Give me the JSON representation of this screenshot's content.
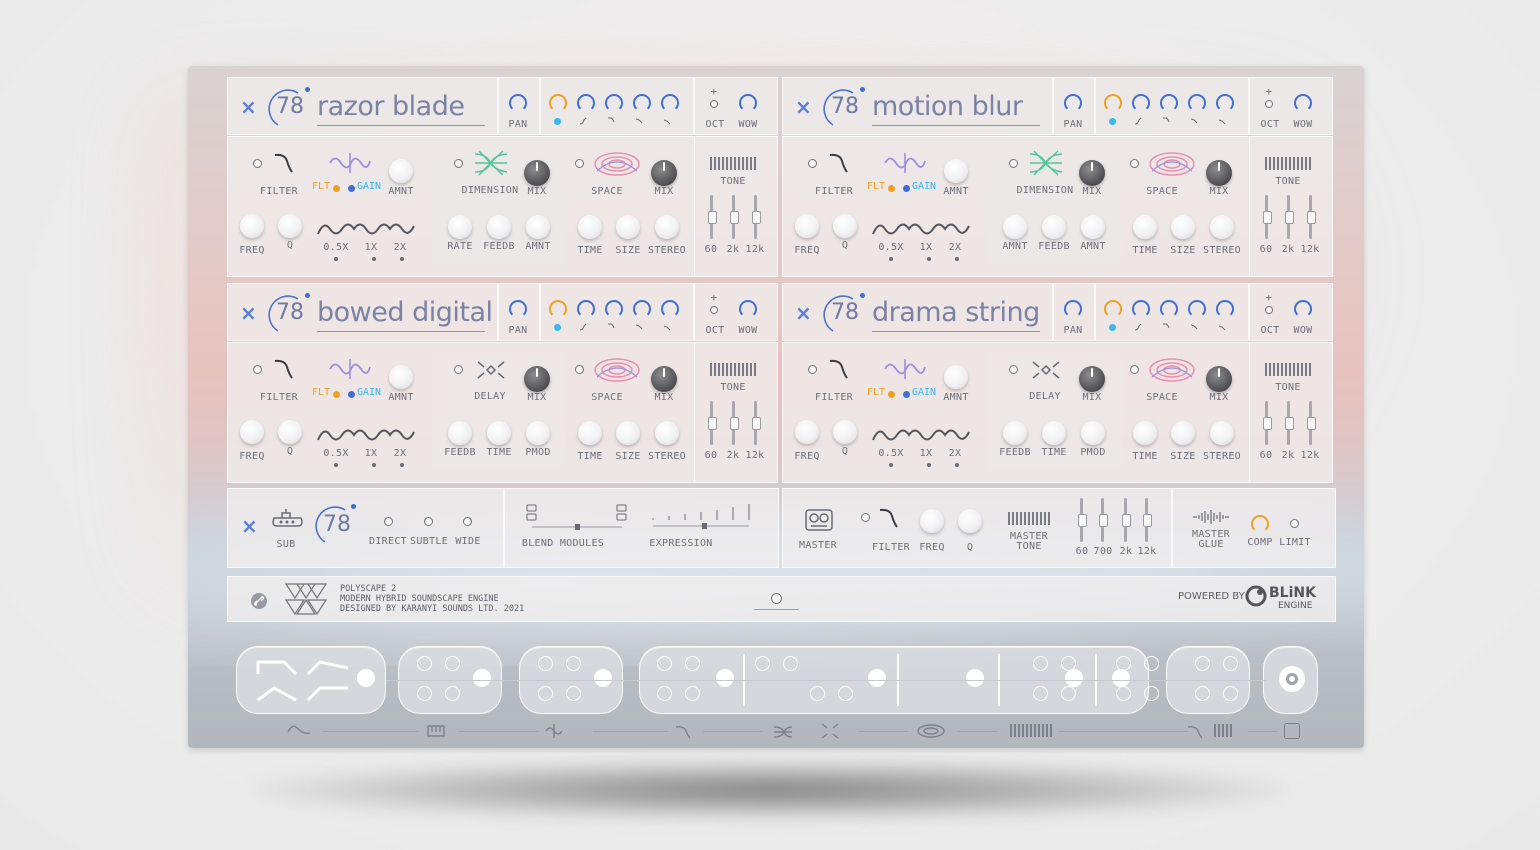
{
  "modules": [
    {
      "id": "m1",
      "name": "razor blade",
      "num": "78",
      "fx1": "DIMENSION",
      "fx1_labels": [
        "RATE",
        "FEEDB",
        "AMNT"
      ]
    },
    {
      "id": "m2",
      "name": "motion blur",
      "num": "78",
      "fx1": "DIMENSION",
      "fx1_labels": [
        "AMNT",
        "FEEDB",
        "AMNT"
      ]
    },
    {
      "id": "m3",
      "name": "bowed digital",
      "num": "78",
      "fx1": "DELAY",
      "fx1_labels": [
        "FEEDB",
        "TIME",
        "PMOD"
      ]
    },
    {
      "id": "m4",
      "name": "drama string",
      "num": "78",
      "fx1": "DELAY",
      "fx1_labels": [
        "FEEDB",
        "TIME",
        "PMOD"
      ]
    }
  ],
  "common": {
    "close": "×",
    "pan": "PAN",
    "oct": "OCT",
    "wow": "WOW",
    "plus": "+",
    "minus": "−",
    "filter": "FILTER",
    "amnt": "AMNT",
    "flt": "FLT",
    "gain": "GAIN",
    "freq": "FREQ",
    "q": "Q",
    "rate_05": "0.5X",
    "rate_1": "1X",
    "rate_2": "2X",
    "mix": "MIX",
    "space": "SPACE",
    "time": "TIME",
    "size": "SIZE",
    "stereo": "STEREO",
    "tone": "TONE",
    "eq": [
      "60",
      "2k",
      "12k"
    ]
  },
  "sub": {
    "num": "78",
    "sub": "SUB",
    "direct": "DIRECT",
    "subtle": "SUBTLE",
    "wide": "WIDE",
    "blend": "BLEND MODULES",
    "expression": "EXPRESSION"
  },
  "master": {
    "master": "MASTER",
    "filter": "FILTER",
    "freq": "FREQ",
    "q": "Q",
    "tone_1": "MASTER",
    "tone_2": "TONE",
    "eq": [
      "60",
      "700",
      "2k",
      "12k"
    ],
    "glue_1": "MASTER",
    "glue_2": "GLUE",
    "comp": "COMP",
    "limit": "LIMIT"
  },
  "footer": {
    "line1": "POLYSCAPE 2",
    "line2": "MODERN HYBRID SOUNDSCAPE ENGINE",
    "line3": "DESIGNED BY KARANYI SOUNDS LTD. 2021",
    "powered": "POWERED BY",
    "brand1": "BLiNK",
    "brand2": "ENGINE"
  },
  "colors": {
    "accent": "#3f6ed4",
    "orange": "#f0a020",
    "cyan": "#38b8ee",
    "purple": "#9a8ee0",
    "green": "#55c59a",
    "pink": "#e88fae"
  }
}
